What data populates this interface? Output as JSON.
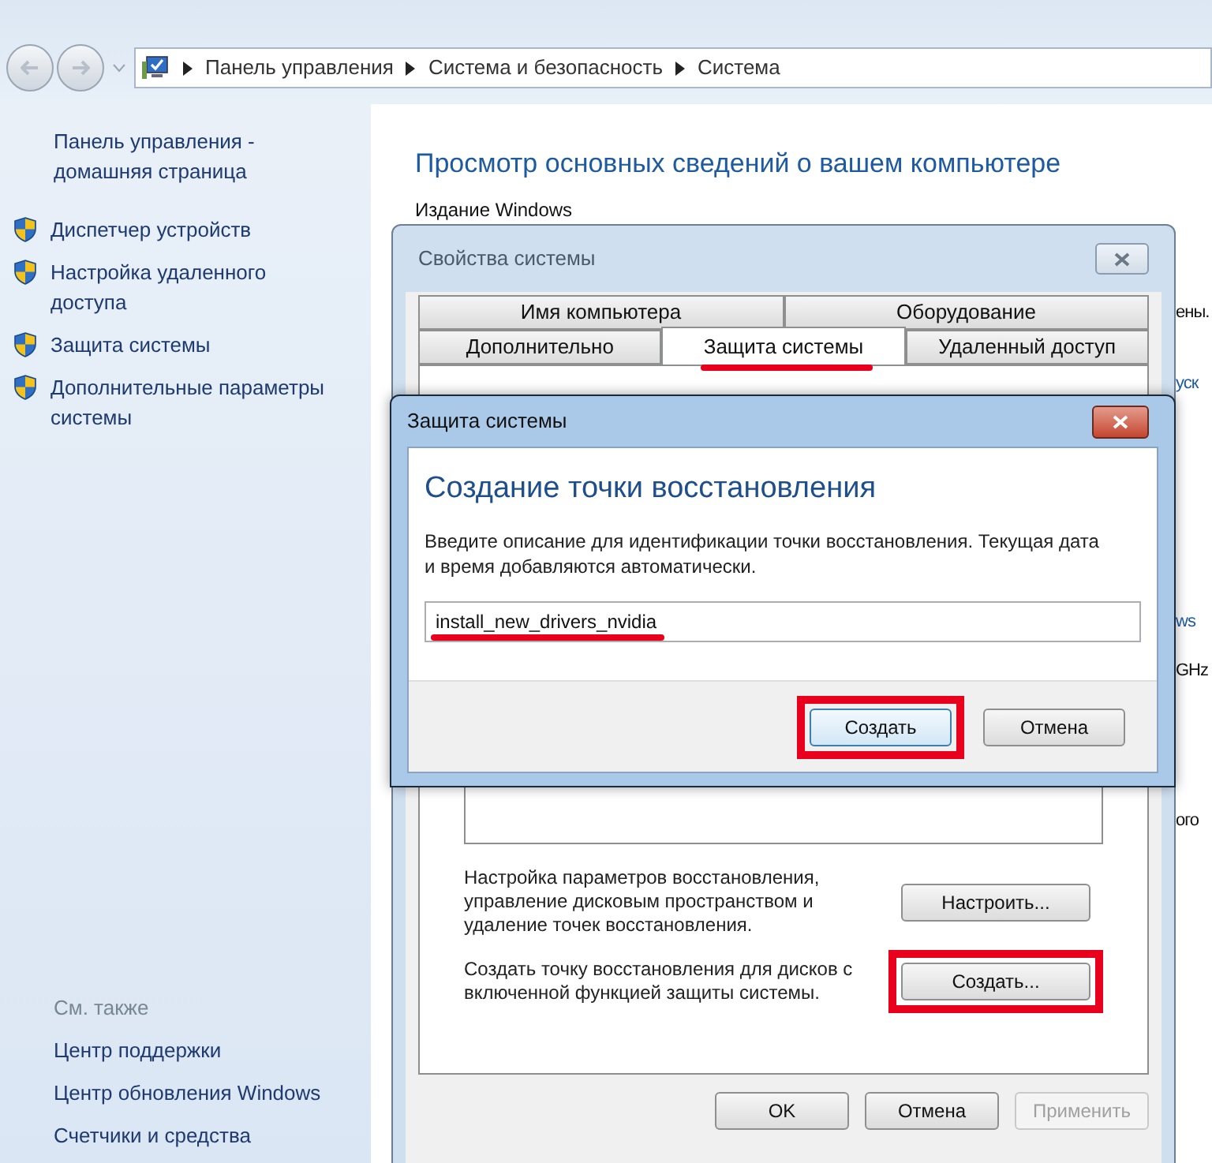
{
  "nav": {
    "breadcrumbs": [
      "Панель управления",
      "Система и безопасность",
      "Система"
    ]
  },
  "sidebar": {
    "home_link": "Панель управления - домашняя страница",
    "items": [
      "Диспетчер устройств",
      "Настройка удаленного доступа",
      "Защита системы",
      "Дополнительные параметры системы"
    ],
    "see_also_title": "См. также",
    "see_also": [
      "Центр поддержки",
      "Центр обновления Windows",
      "Счетчики и средства"
    ]
  },
  "main": {
    "heading": "Просмотр основных сведений о вашем компьютере",
    "section_label": "Издание Windows",
    "clipped_texts": [
      {
        "text": "ены.",
        "kind": "plain"
      },
      {
        "text": "уск",
        "kind": "link"
      },
      {
        "text": "ws",
        "kind": "link"
      },
      {
        "text": "GHz",
        "kind": "plain"
      },
      {
        "text": "ого",
        "kind": "plain"
      }
    ]
  },
  "system_properties": {
    "title": "Свойства системы",
    "tab_rows": [
      [
        {
          "label": "Имя компьютера",
          "selected": false,
          "underlined": false
        },
        {
          "label": "Оборудование",
          "selected": false,
          "underlined": false
        }
      ],
      [
        {
          "label": "Дополнительно",
          "selected": false,
          "underlined": false
        },
        {
          "label": "Защита системы",
          "selected": true,
          "underlined": true
        },
        {
          "label": "Удаленный доступ",
          "selected": false,
          "underlined": false
        }
      ]
    ],
    "actions": [
      {
        "text": "Настройка параметров восстановления, управление дисковым пространством и удаление точек восстановления.",
        "button": "Настроить...",
        "highlighted": false
      },
      {
        "text": "Создать точку восстановления для дисков с включенной функцией защиты системы.",
        "button": "Создать...",
        "highlighted": true
      }
    ],
    "buttons": [
      {
        "label": "OK",
        "disabled": false
      },
      {
        "label": "Отмена",
        "disabled": false
      },
      {
        "label": "Применить",
        "disabled": true
      }
    ]
  },
  "create_restore_point": {
    "title": "Защита системы",
    "heading": "Создание точки восстановления",
    "description": "Введите описание для идентификации точки восстановления. Текущая дата и время добавляются автоматически.",
    "input": {
      "value": "install_new_drivers_nvidia",
      "underlined": true
    },
    "buttons": [
      {
        "label": "Создать",
        "default": true,
        "highlighted": true
      },
      {
        "label": "Отмена",
        "default": false,
        "highlighted": false
      }
    ]
  }
}
